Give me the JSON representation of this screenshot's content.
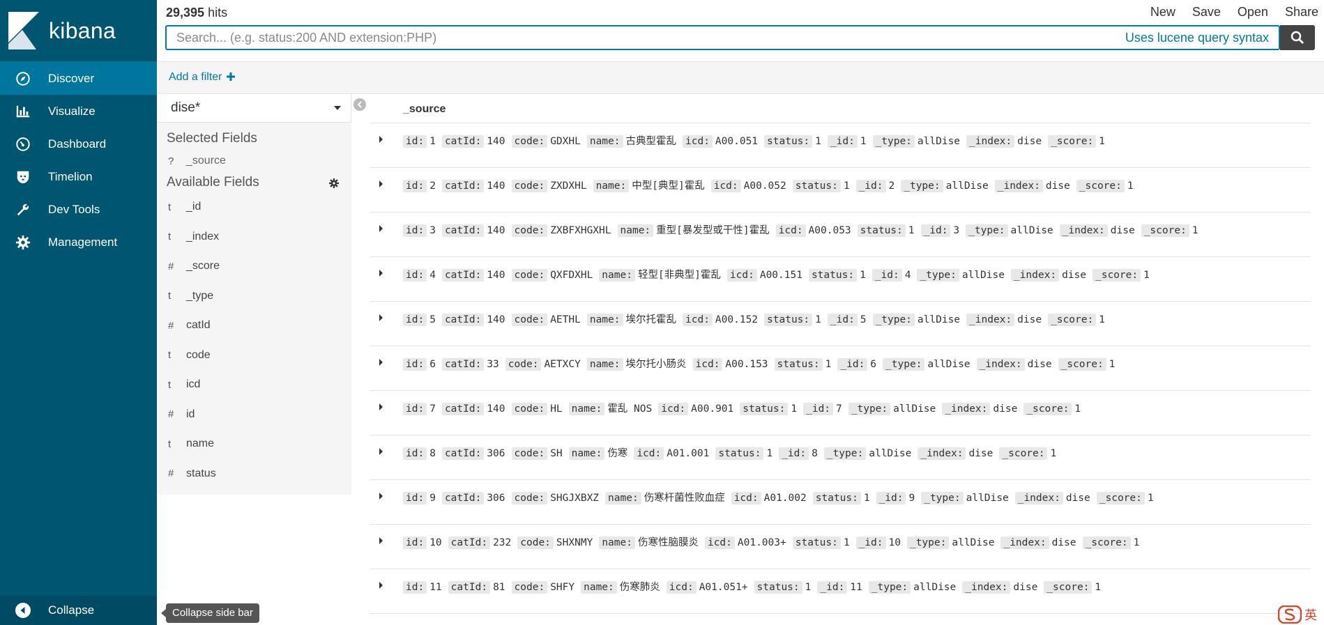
{
  "brand": {
    "name": "kibana"
  },
  "nav": {
    "items": [
      {
        "label": "Discover",
        "icon": "compass-icon",
        "active": true
      },
      {
        "label": "Visualize",
        "icon": "bar-chart-icon",
        "active": false
      },
      {
        "label": "Dashboard",
        "icon": "dashboard-icon",
        "active": false
      },
      {
        "label": "Timelion",
        "icon": "timelion-icon",
        "active": false
      },
      {
        "label": "Dev Tools",
        "icon": "wrench-icon",
        "active": false
      },
      {
        "label": "Management",
        "icon": "gear-icon",
        "active": false
      }
    ],
    "collapse_label": "Collapse",
    "collapse_tooltip": "Collapse side bar"
  },
  "header": {
    "hits_count": "29,395",
    "hits_label": "hits",
    "actions": [
      "New",
      "Save",
      "Open",
      "Share"
    ]
  },
  "search": {
    "placeholder": "Search... (e.g. status:200 AND extension:PHP)",
    "value": "",
    "syntax_link": "Uses lucene query syntax"
  },
  "filters": {
    "add_label": "Add a filter"
  },
  "sidebar": {
    "index_pattern": "dise*",
    "selected_title": "Selected Fields",
    "selected_fields": [
      {
        "type": "?",
        "name": "_source"
      }
    ],
    "available_title": "Available Fields",
    "available_fields": [
      {
        "type": "t",
        "name": "_id"
      },
      {
        "type": "t",
        "name": "_index"
      },
      {
        "type": "#",
        "name": "_score"
      },
      {
        "type": "t",
        "name": "_type"
      },
      {
        "type": "#",
        "name": "catId"
      },
      {
        "type": "t",
        "name": "code"
      },
      {
        "type": "t",
        "name": "icd"
      },
      {
        "type": "#",
        "name": "id"
      },
      {
        "type": "t",
        "name": "name"
      },
      {
        "type": "#",
        "name": "status"
      }
    ]
  },
  "documents": {
    "column_header": "_source",
    "rows": [
      [
        [
          "id:",
          "1"
        ],
        [
          "catId:",
          "140"
        ],
        [
          "code:",
          "GDXHL"
        ],
        [
          "name:",
          "古典型霍乱"
        ],
        [
          "icd:",
          "A00.051"
        ],
        [
          "status:",
          "1"
        ],
        [
          "_id:",
          "1"
        ],
        [
          "_type:",
          "allDise"
        ],
        [
          "_index:",
          "dise"
        ],
        [
          "_score:",
          "1"
        ]
      ],
      [
        [
          "id:",
          "2"
        ],
        [
          "catId:",
          "140"
        ],
        [
          "code:",
          "ZXDXHL"
        ],
        [
          "name:",
          "中型[典型]霍乱"
        ],
        [
          "icd:",
          "A00.052"
        ],
        [
          "status:",
          "1"
        ],
        [
          "_id:",
          "2"
        ],
        [
          "_type:",
          "allDise"
        ],
        [
          "_index:",
          "dise"
        ],
        [
          "_score:",
          "1"
        ]
      ],
      [
        [
          "id:",
          "3"
        ],
        [
          "catId:",
          "140"
        ],
        [
          "code:",
          "ZXBFXHGXHL"
        ],
        [
          "name:",
          "重型[暴发型或干性]霍乱"
        ],
        [
          "icd:",
          "A00.053"
        ],
        [
          "status:",
          "1"
        ],
        [
          "_id:",
          "3"
        ],
        [
          "_type:",
          "allDise"
        ],
        [
          "_index:",
          "dise"
        ],
        [
          "_score:",
          "1"
        ]
      ],
      [
        [
          "id:",
          "4"
        ],
        [
          "catId:",
          "140"
        ],
        [
          "code:",
          "QXFDXHL"
        ],
        [
          "name:",
          "轻型[非典型]霍乱"
        ],
        [
          "icd:",
          "A00.151"
        ],
        [
          "status:",
          "1"
        ],
        [
          "_id:",
          "4"
        ],
        [
          "_type:",
          "allDise"
        ],
        [
          "_index:",
          "dise"
        ],
        [
          "_score:",
          "1"
        ]
      ],
      [
        [
          "id:",
          "5"
        ],
        [
          "catId:",
          "140"
        ],
        [
          "code:",
          "AETHL"
        ],
        [
          "name:",
          "埃尔托霍乱"
        ],
        [
          "icd:",
          "A00.152"
        ],
        [
          "status:",
          "1"
        ],
        [
          "_id:",
          "5"
        ],
        [
          "_type:",
          "allDise"
        ],
        [
          "_index:",
          "dise"
        ],
        [
          "_score:",
          "1"
        ]
      ],
      [
        [
          "id:",
          "6"
        ],
        [
          "catId:",
          "33"
        ],
        [
          "code:",
          "AETXCY"
        ],
        [
          "name:",
          "埃尔托小肠炎"
        ],
        [
          "icd:",
          "A00.153"
        ],
        [
          "status:",
          "1"
        ],
        [
          "_id:",
          "6"
        ],
        [
          "_type:",
          "allDise"
        ],
        [
          "_index:",
          "dise"
        ],
        [
          "_score:",
          "1"
        ]
      ],
      [
        [
          "id:",
          "7"
        ],
        [
          "catId:",
          "140"
        ],
        [
          "code:",
          "HL"
        ],
        [
          "name:",
          "霍乱 NOS"
        ],
        [
          "icd:",
          "A00.901"
        ],
        [
          "status:",
          "1"
        ],
        [
          "_id:",
          "7"
        ],
        [
          "_type:",
          "allDise"
        ],
        [
          "_index:",
          "dise"
        ],
        [
          "_score:",
          "1"
        ]
      ],
      [
        [
          "id:",
          "8"
        ],
        [
          "catId:",
          "306"
        ],
        [
          "code:",
          "SH"
        ],
        [
          "name:",
          "伤寒"
        ],
        [
          "icd:",
          "A01.001"
        ],
        [
          "status:",
          "1"
        ],
        [
          "_id:",
          "8"
        ],
        [
          "_type:",
          "allDise"
        ],
        [
          "_index:",
          "dise"
        ],
        [
          "_score:",
          "1"
        ]
      ],
      [
        [
          "id:",
          "9"
        ],
        [
          "catId:",
          "306"
        ],
        [
          "code:",
          "SHGJXBXZ"
        ],
        [
          "name:",
          "伤寒杆菌性败血症"
        ],
        [
          "icd:",
          "A01.002"
        ],
        [
          "status:",
          "1"
        ],
        [
          "_id:",
          "9"
        ],
        [
          "_type:",
          "allDise"
        ],
        [
          "_index:",
          "dise"
        ],
        [
          "_score:",
          "1"
        ]
      ],
      [
        [
          "id:",
          "10"
        ],
        [
          "catId:",
          "232"
        ],
        [
          "code:",
          "SHXNMY"
        ],
        [
          "name:",
          "伤寒性脑膜炎"
        ],
        [
          "icd:",
          "A01.003+"
        ],
        [
          "status:",
          "1"
        ],
        [
          "_id:",
          "10"
        ],
        [
          "_type:",
          "allDise"
        ],
        [
          "_index:",
          "dise"
        ],
        [
          "_score:",
          "1"
        ]
      ],
      [
        [
          "id:",
          "11"
        ],
        [
          "catId:",
          "81"
        ],
        [
          "code:",
          "SHFY"
        ],
        [
          "name:",
          "伤寒肺炎"
        ],
        [
          "icd:",
          "A01.051+"
        ],
        [
          "status:",
          "1"
        ],
        [
          "_id:",
          "11"
        ],
        [
          "_type:",
          "allDise"
        ],
        [
          "_index:",
          "dise"
        ],
        [
          "_score:",
          "1"
        ]
      ]
    ]
  },
  "ime": {
    "label": "英"
  },
  "colors": {
    "nav_bg": "#005571",
    "nav_active": "#00769e",
    "link": "#0079a5",
    "search_border": "#0079a5"
  }
}
